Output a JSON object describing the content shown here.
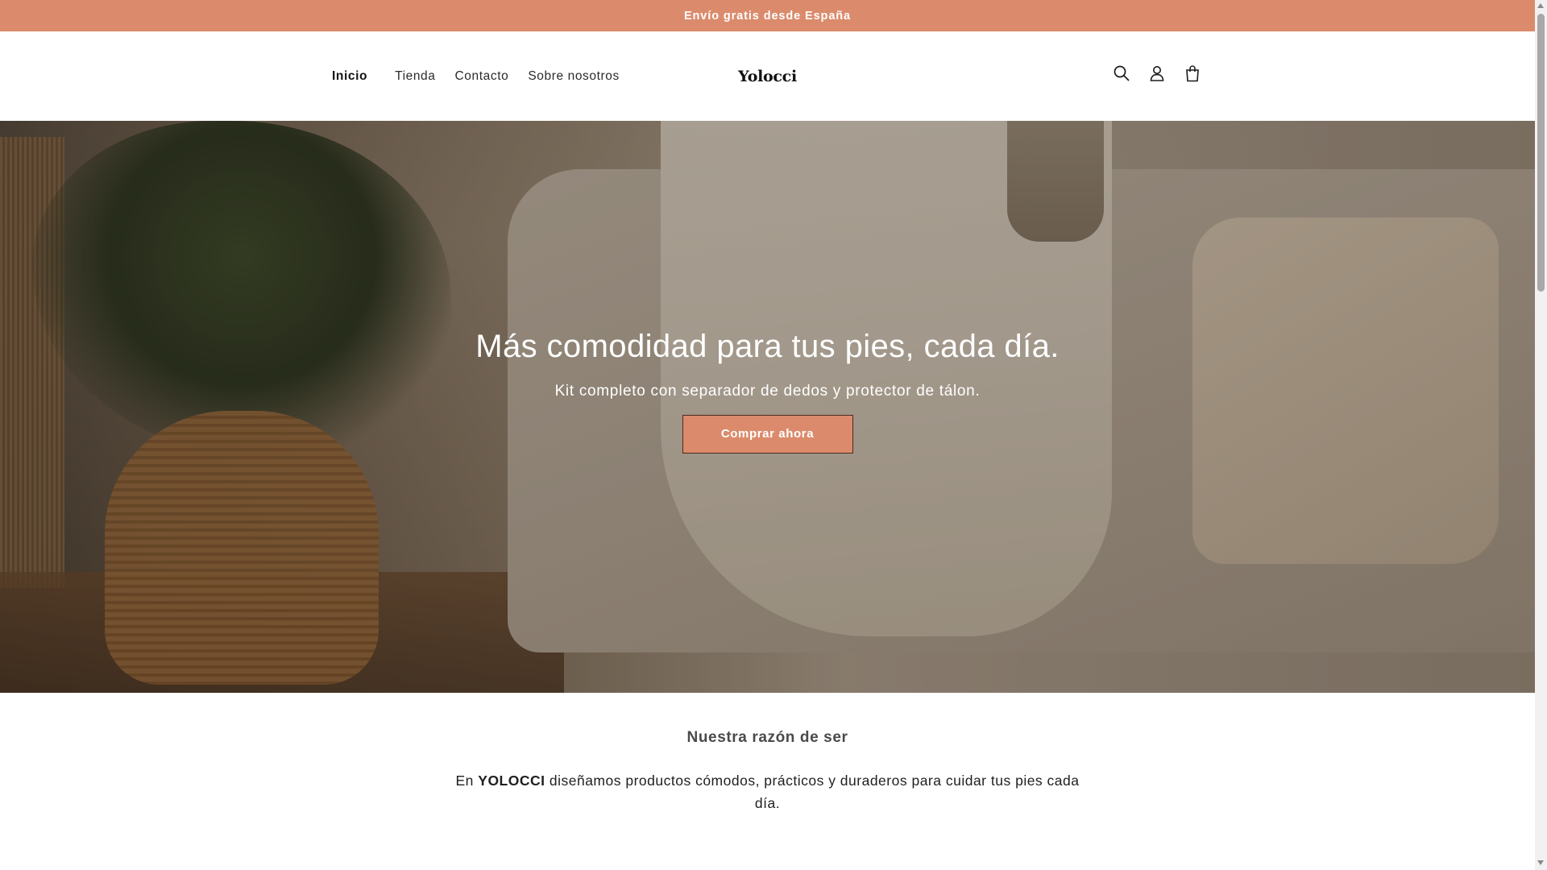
{
  "announcement": {
    "text": "Envío gratis desde España"
  },
  "header": {
    "nav": [
      {
        "label": "Inicio",
        "active": true
      },
      {
        "label": "Tienda",
        "active": false
      },
      {
        "label": "Contacto",
        "active": false
      },
      {
        "label": "Sobre nosotros",
        "active": false
      }
    ],
    "logo": "Yolocci",
    "icons": [
      "search-icon",
      "account-icon",
      "cart-icon"
    ]
  },
  "hero": {
    "title": "Más comodidad para tus pies, cada día.",
    "subtitle": "Kit completo con separador de dedos y protector de tálon.",
    "button_label": "Comprar ahora"
  },
  "about": {
    "title": "Nuestra razón de ser",
    "text_prefix": "En ",
    "brand": "YOLOCCI",
    "text_suffix": " diseñamos productos cómodos, prácticos y duraderos para cuidar tus pies cada día."
  },
  "colors": {
    "accent": "#db8b6c",
    "text": "#121212",
    "background": "#ffffff"
  }
}
